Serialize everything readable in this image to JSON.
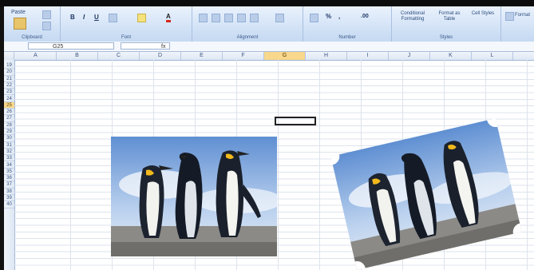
{
  "ribbon": {
    "clipboard": {
      "paste_label": "Paste",
      "group_label": "Clipboard"
    },
    "font": {
      "group_label": "Font"
    },
    "alignment": {
      "group_label": "Alignment"
    },
    "number": {
      "group_label": "Number",
      "percent": "%",
      "comma": ",",
      "inc_dec": ".00"
    },
    "styles": {
      "group_label": "Styles",
      "conditional_formatting": "Conditional Formatting",
      "format_as_table": "Format as Table",
      "cell_styles": "Cell Styles"
    },
    "cells": {
      "label": "Format"
    }
  },
  "formula_bar": {
    "name_box": "G25",
    "fx_label": "fx"
  },
  "columns": [
    "A",
    "B",
    "C",
    "D",
    "E",
    "F",
    "G",
    "H",
    "I",
    "J",
    "K",
    "L"
  ],
  "active_column": "G",
  "rows": [
    "19",
    "20",
    "21",
    "22",
    "23",
    "24",
    "25",
    "26",
    "27",
    "28",
    "29",
    "30",
    "31",
    "32",
    "33",
    "34",
    "35",
    "36",
    "37",
    "38",
    "39",
    "40"
  ],
  "active_row": "25",
  "images": [
    {
      "name": "penguins-original",
      "subject": "three emperor penguins on a beach"
    },
    {
      "name": "penguins-rotated-cropped",
      "subject": "three emperor penguins, rotated and cut to a shape"
    }
  ],
  "colors": {
    "ribbon": "#d5e4f7",
    "active_header": "#f8d88c",
    "gridline": "#dde3ec"
  }
}
